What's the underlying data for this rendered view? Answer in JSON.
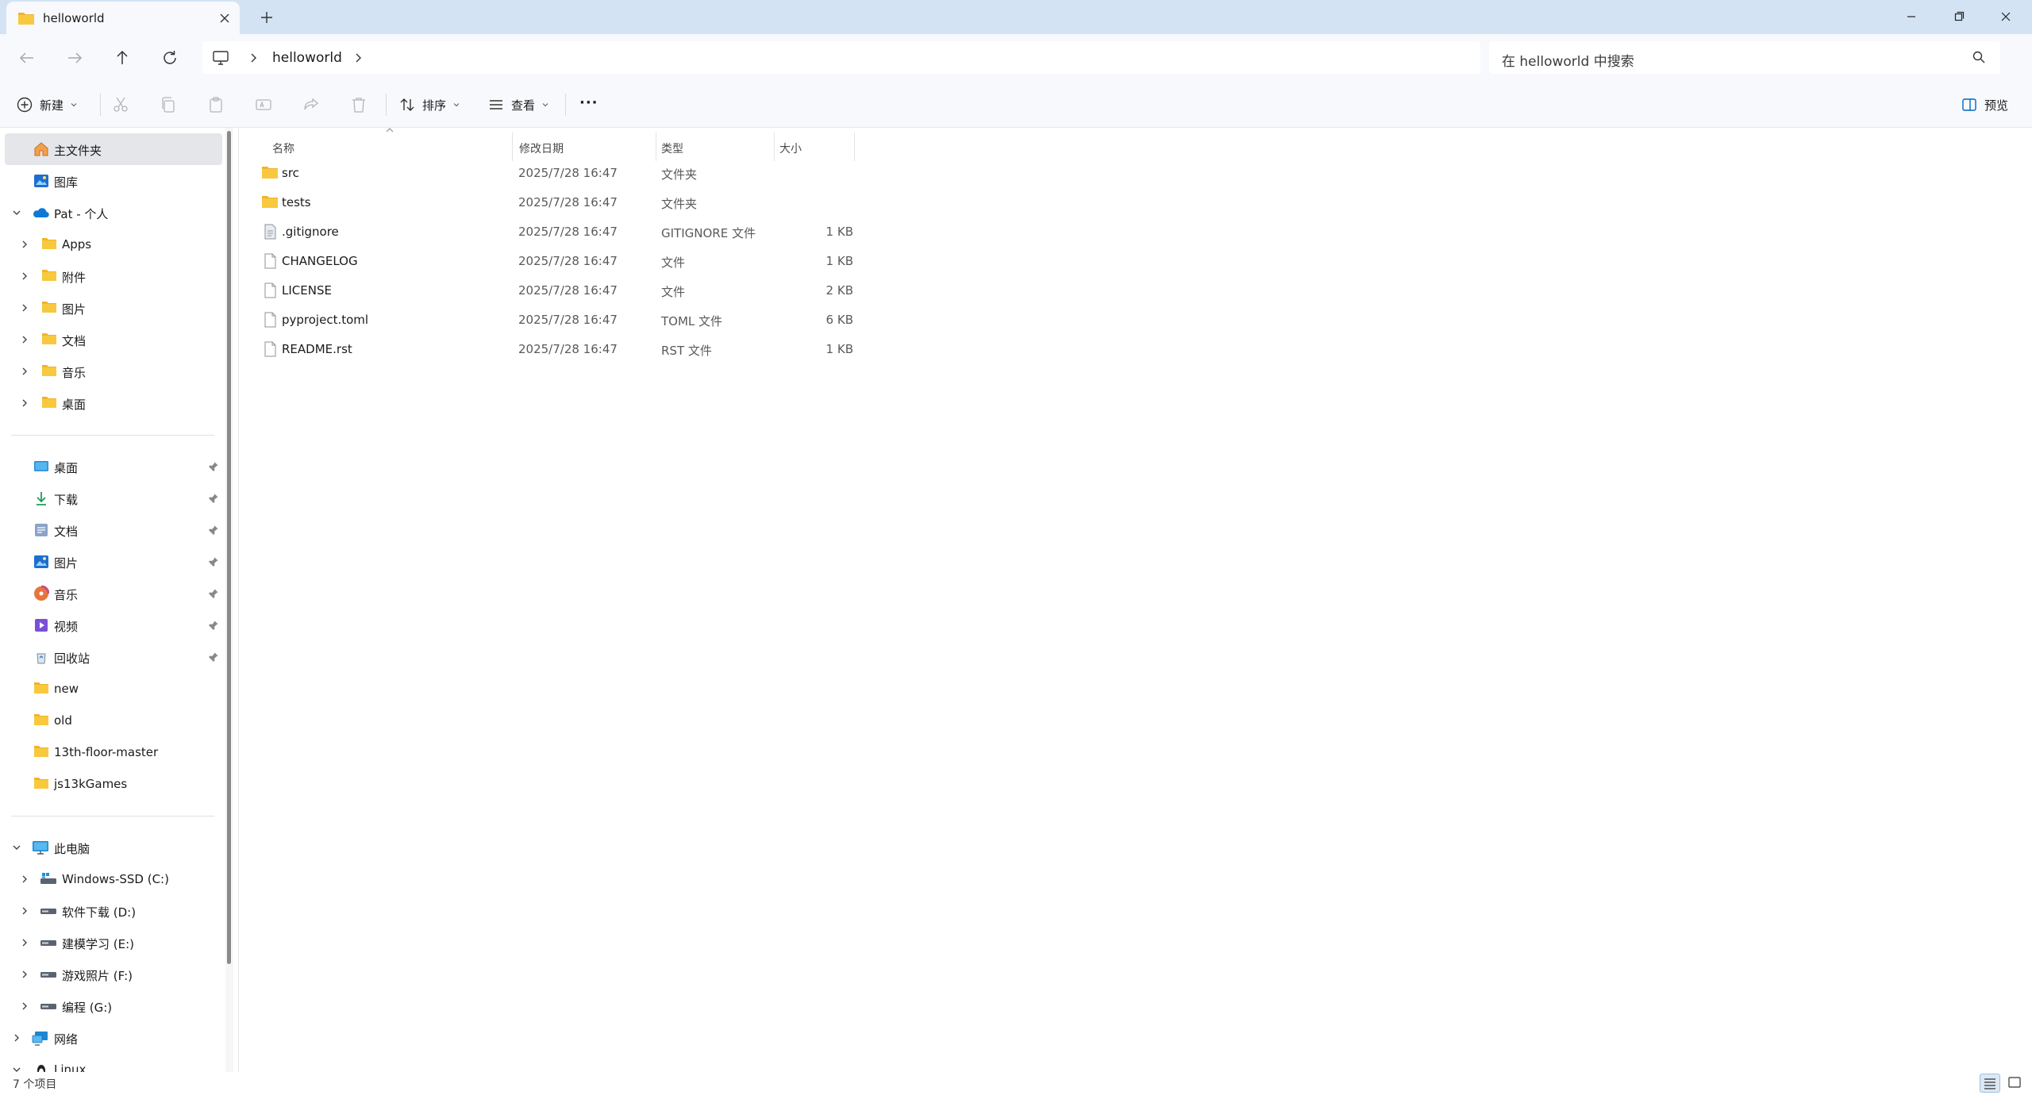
{
  "window": {
    "tab_title": "helloworld",
    "new_tab_label": "+"
  },
  "address": {
    "path": [
      "helloworld"
    ],
    "search_placeholder": "在 helloworld 中搜索"
  },
  "toolbar": {
    "new_label": "新建",
    "sort_label": "排序",
    "view_label": "查看",
    "more_label": "···",
    "preview_label": "预览"
  },
  "sidebar": {
    "quick": [
      {
        "label": "主文件夹",
        "icon": "home-icon",
        "selected": true
      },
      {
        "label": "图库",
        "icon": "gallery-icon"
      }
    ],
    "onedrive": {
      "label": "Pat - 个人",
      "icon": "onedrive-cloud-icon",
      "children": [
        "Apps",
        "附件",
        "图片",
        "文档",
        "音乐",
        "桌面"
      ]
    },
    "pinned": [
      {
        "label": "桌面",
        "icon": "desktop-icon"
      },
      {
        "label": "下载",
        "icon": "download-icon"
      },
      {
        "label": "文档",
        "icon": "documents-icon"
      },
      {
        "label": "图片",
        "icon": "pictures-icon"
      },
      {
        "label": "音乐",
        "icon": "music-icon"
      },
      {
        "label": "视频",
        "icon": "video-icon"
      },
      {
        "label": "回收站",
        "icon": "recycle-bin-icon"
      }
    ],
    "folders": [
      "new",
      "old",
      "13th-floor-master",
      "js13kGames"
    ],
    "this_pc": {
      "label": "此电脑",
      "drives": [
        "Windows-SSD (C:)",
        "软件下载 (D:)",
        "建模学习 (E:)",
        "游戏照片 (F:)",
        "编程 (G:)"
      ]
    },
    "network": "网络",
    "linux": "Linux"
  },
  "columns": {
    "name": "名称",
    "modified": "修改日期",
    "type": "类型",
    "size": "大小"
  },
  "files": [
    {
      "name": "src",
      "modified": "2025/7/28 16:47",
      "type": "文件夹",
      "size": "",
      "kind": "folder"
    },
    {
      "name": "tests",
      "modified": "2025/7/28 16:47",
      "type": "文件夹",
      "size": "",
      "kind": "folder"
    },
    {
      "name": ".gitignore",
      "modified": "2025/7/28 16:47",
      "type": "GITIGNORE 文件",
      "size": "1 KB",
      "kind": "config"
    },
    {
      "name": "CHANGELOG",
      "modified": "2025/7/28 16:47",
      "type": "文件",
      "size": "1 KB",
      "kind": "file"
    },
    {
      "name": "LICENSE",
      "modified": "2025/7/28 16:47",
      "type": "文件",
      "size": "2 KB",
      "kind": "file"
    },
    {
      "name": "pyproject.toml",
      "modified": "2025/7/28 16:47",
      "type": "TOML 文件",
      "size": "6 KB",
      "kind": "file"
    },
    {
      "name": "README.rst",
      "modified": "2025/7/28 16:47",
      "type": "RST 文件",
      "size": "1 KB",
      "kind": "file"
    }
  ],
  "status": {
    "item_count": "7 个项目"
  },
  "colors": {
    "titlebar": "#d3e3f3",
    "chrome": "#f7f9fc",
    "selection": "#e4e6ea",
    "folder": "#f8c93e",
    "accent": "#0067c0"
  }
}
